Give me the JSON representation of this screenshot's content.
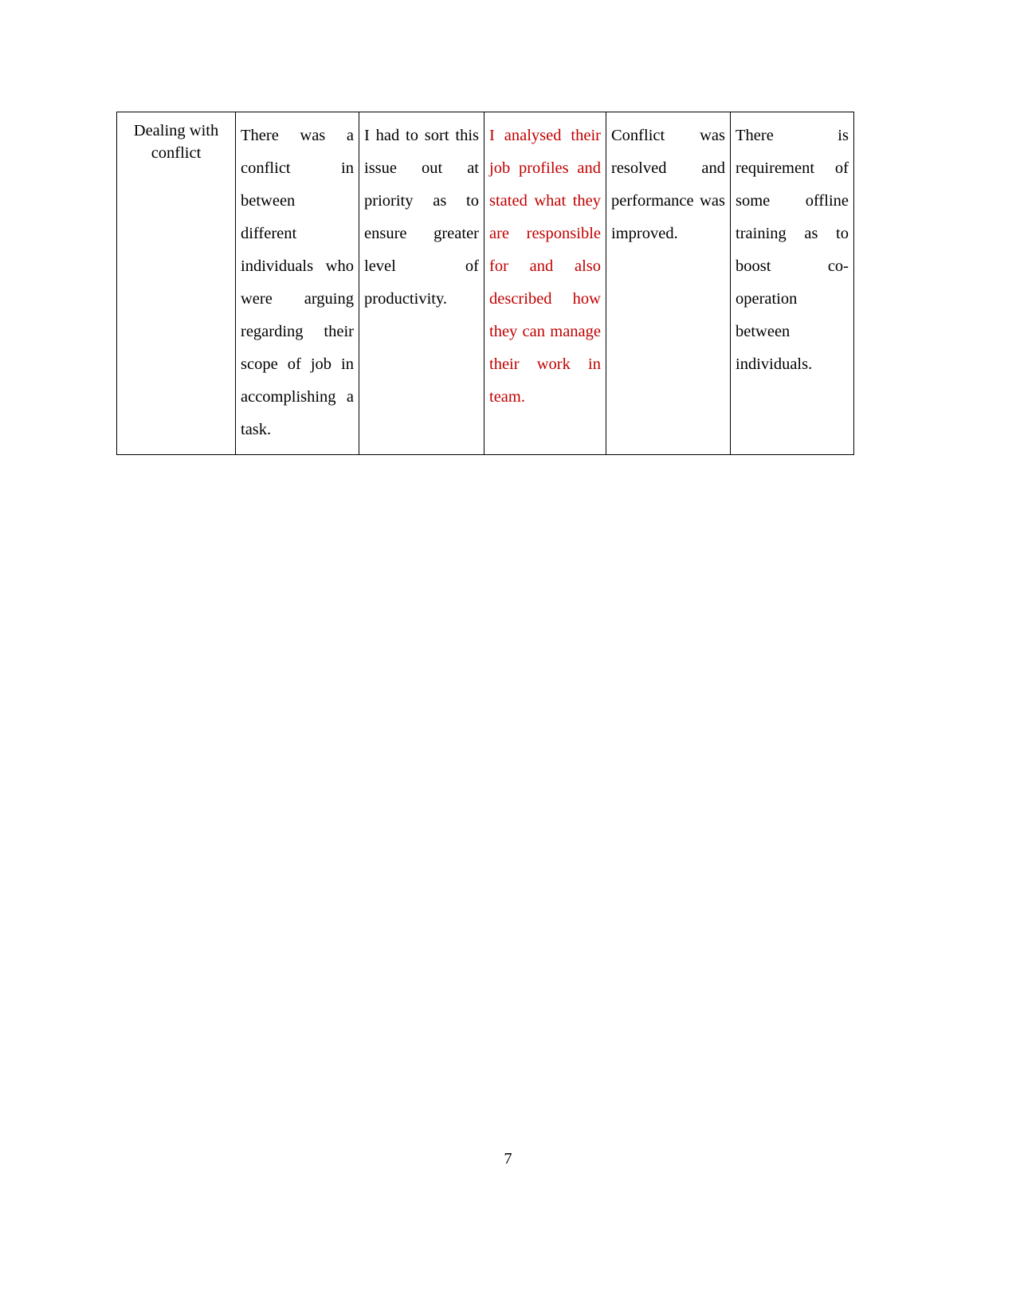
{
  "document": {
    "page_number": "7",
    "accent_color": "#C00000",
    "text_color": "#000000",
    "border_color": "#000000"
  },
  "table": {
    "rows": [
      {
        "cells": [
          {
            "id": "topic",
            "align": "center",
            "color": "#000000",
            "text": "Dealing with conflict"
          },
          {
            "id": "description",
            "align": "justify",
            "color": "#000000",
            "text": "There was a conflict in between different individuals who were arguing regarding their scope of job in accomplishing a task."
          },
          {
            "id": "feelings",
            "align": "justify",
            "color": "#000000",
            "text": "I had to sort this issue out at priority as to ensure greater level of productivity."
          },
          {
            "id": "evaluation",
            "align": "justify",
            "color": "#C00000",
            "text": "I analysed their job profiles and stated what they are responsible for and also described how they can manage their work in team."
          },
          {
            "id": "conclusion",
            "align": "justify",
            "color": "#000000",
            "text": "Conflict was resolved and performance was improved."
          },
          {
            "id": "action-plan",
            "align": "justify",
            "color": "#000000",
            "text": "There is requirement of some offline training as to boost co-operation between individuals."
          }
        ]
      }
    ]
  }
}
